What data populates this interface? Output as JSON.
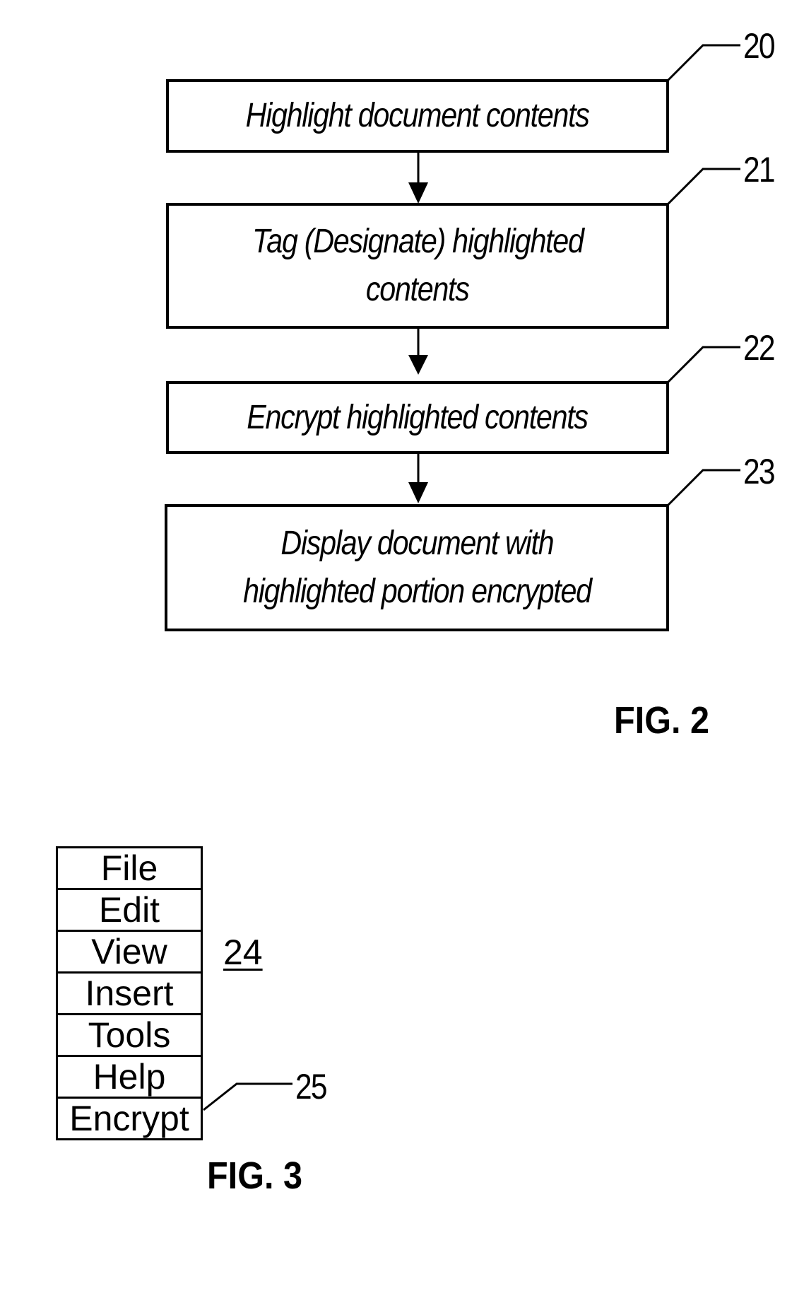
{
  "fig2": {
    "caption": "FIG. 2",
    "steps": [
      {
        "ref": "20",
        "lines": [
          "Highlight document contents"
        ]
      },
      {
        "ref": "21",
        "lines": [
          "Tag (Designate) highlighted",
          "contents"
        ]
      },
      {
        "ref": "22",
        "lines": [
          "Encrypt highlighted contents"
        ]
      },
      {
        "ref": "23",
        "lines": [
          "Display document with",
          "highlighted portion encrypted"
        ]
      }
    ]
  },
  "fig3": {
    "caption": "FIG. 3",
    "menu_ref": "24",
    "encrypt_ref": "25",
    "menu_items": [
      "File",
      "Edit",
      "View",
      "Insert",
      "Tools",
      "Help",
      "Encrypt"
    ]
  }
}
